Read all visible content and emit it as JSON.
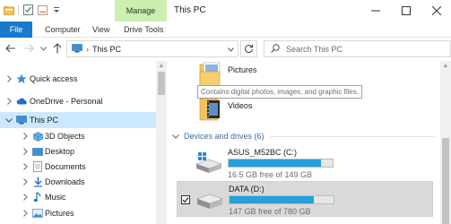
{
  "window": {
    "title": "This PC",
    "manage_tab": "Manage"
  },
  "ribbon": {
    "tabs": [
      {
        "label": "File",
        "active": true
      },
      {
        "label": "Computer"
      },
      {
        "label": "View"
      },
      {
        "label": "Drive Tools"
      }
    ]
  },
  "address": {
    "path": [
      "This PC"
    ],
    "search_placeholder": "Search This PC"
  },
  "sidebar": {
    "items": [
      {
        "label": "Quick access",
        "icon": "star-icon",
        "level": 0
      },
      {
        "label": "OneDrive - Personal",
        "icon": "cloud-icon",
        "level": 0
      },
      {
        "label": "This PC",
        "icon": "computer-icon",
        "level": 0,
        "expanded": true,
        "selected": true
      },
      {
        "label": "3D Objects",
        "icon": "3d-objects-icon",
        "level": 1
      },
      {
        "label": "Desktop",
        "icon": "desktop-folder-icon",
        "level": 1
      },
      {
        "label": "Documents",
        "icon": "documents-icon",
        "level": 1
      },
      {
        "label": "Downloads",
        "icon": "downloads-icon",
        "level": 1
      },
      {
        "label": "Music",
        "icon": "music-icon",
        "level": 1
      },
      {
        "label": "Pictures",
        "icon": "pictures-icon",
        "level": 1
      }
    ]
  },
  "content": {
    "folders": [
      {
        "name": "Pictures",
        "icon": "pictures-folder-icon",
        "tooltip": "Contains digital photos, images, and graphic files."
      },
      {
        "name": "Videos",
        "icon": "videos-folder-icon"
      }
    ],
    "group": {
      "label": "Devices and drives (6)",
      "expanded": true
    },
    "drives": [
      {
        "name": "ASUS_M52BC (C:)",
        "free_text": "16.5 GB free of 149 GB",
        "used_fraction": 0.889,
        "selected": false
      },
      {
        "name": "DATA (D:)",
        "free_text": "147 GB free of 780 GB",
        "used_fraction": 0.812,
        "selected": true,
        "checked": true
      }
    ]
  },
  "colors": {
    "accent": "#1979ca",
    "manage_tab": "#ccefb0",
    "selection": "#cce8ff",
    "drive_bar": "#26a0da",
    "group_header": "#3c6aa1"
  }
}
